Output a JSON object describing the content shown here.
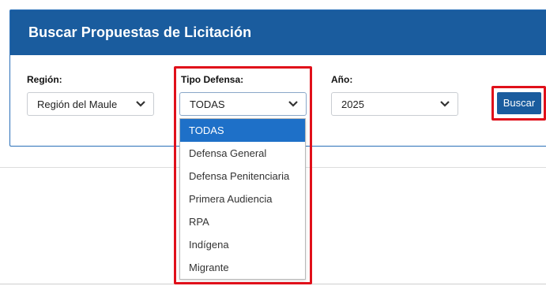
{
  "panel": {
    "title": "Buscar Propuestas de Licitación"
  },
  "region": {
    "label": "Región:",
    "value": "Región del Maule"
  },
  "tipo_defensa": {
    "label": "Tipo Defensa:",
    "value": "TODAS",
    "options": [
      "TODAS",
      "Defensa General",
      "Defensa Penitenciaria",
      "Primera Audiencia",
      "RPA",
      "Indígena",
      "Migrante"
    ],
    "selected_index": 0
  },
  "anio": {
    "label": "Año:",
    "value": "2025"
  },
  "search_button": {
    "label": "Buscar"
  },
  "colors": {
    "header": "#1a5c9e",
    "button": "#1a5c9e",
    "selected_option": "#1e70c8",
    "highlight": "#e0101a"
  },
  "icons": {
    "select_chevron": "chevron-down-icon"
  }
}
